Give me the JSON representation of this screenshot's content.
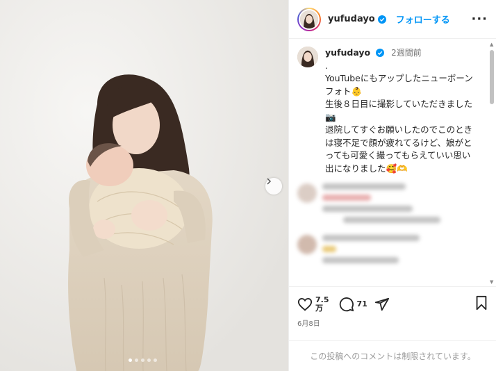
{
  "post": {
    "images_count": 5,
    "active_image_index": 0
  },
  "header": {
    "username": "yufudayo",
    "follow_label": "フォローする",
    "more_label": "···"
  },
  "caption": {
    "username": "yufudayo",
    "time": "2週間前",
    "lines": [
      ".",
      "YouTubeにもアップしたニューボーン",
      "フォト👶",
      "生後８日目に撮影していただきました",
      "📷",
      "退院してすぐお願いしたのでこのとき",
      "は寝不足で顔が疲れてるけど、娘がと",
      "っても可愛く撮ってもらえていい思い",
      "出になりました🥰🫶"
    ]
  },
  "actions": {
    "likes": "7.5",
    "likes_unit": "万",
    "comments": "71",
    "date": "6月8日"
  },
  "comment_box": {
    "notice": "この投稿へのコメントは制限されています。"
  },
  "colors": {
    "accent": "#0095f6",
    "text": "#262626",
    "muted": "#737373"
  }
}
